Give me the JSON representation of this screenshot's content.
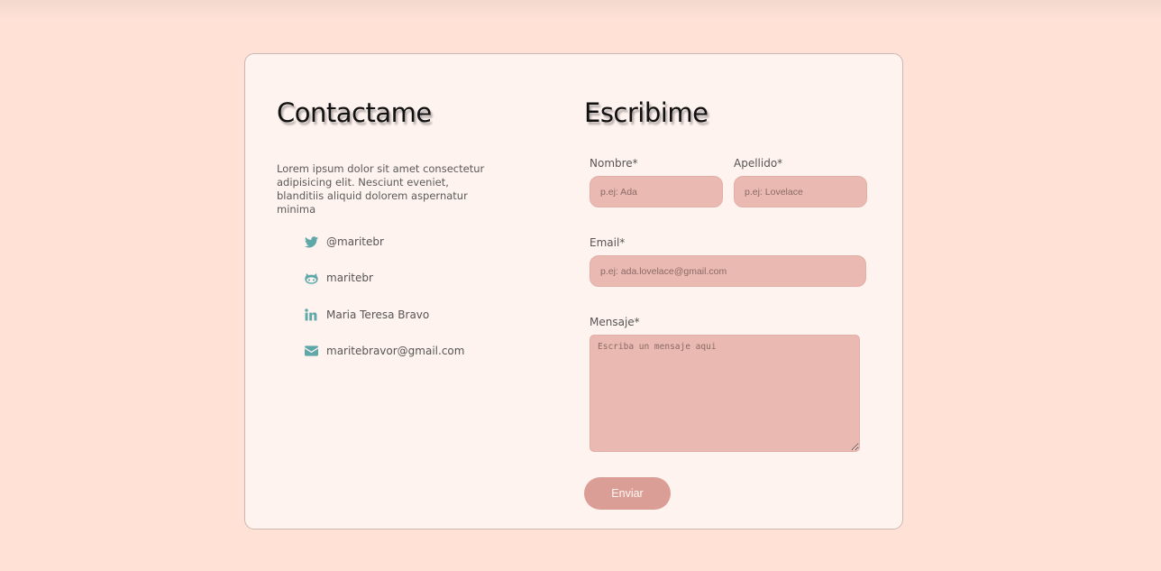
{
  "contact": {
    "title": "Contactame",
    "description": "Lorem ipsum dolor sit amet consectetur adipisicing elit. Nesciunt eveniet, blanditiis aliquid dolorem aspernatur minima",
    "items": [
      {
        "icon": "twitter-icon",
        "label": "@maritebr"
      },
      {
        "icon": "github-icon",
        "label": "maritebr"
      },
      {
        "icon": "linkedin-icon",
        "label": "Maria Teresa Bravo"
      },
      {
        "icon": "envelope-icon",
        "label": "maritebravor@gmail.com"
      }
    ]
  },
  "form": {
    "title": "Escribime",
    "nombre": {
      "label": "Nombre*",
      "placeholder": "p.ej: Ada"
    },
    "apellido": {
      "label": "Apellido*",
      "placeholder": "p.ej: Lovelace"
    },
    "email": {
      "label": "Email*",
      "placeholder": "p.ej: ada.lovelace@gmail.com"
    },
    "mensaje": {
      "label": "Mensaje*",
      "placeholder": "Escriba un mensaje aqui"
    },
    "submit_label": "Enviar"
  },
  "colors": {
    "page_background": "#ffe1d6",
    "card_background": "#fff3ef",
    "input_background": "#eab9b1",
    "button_background": "#db9e96",
    "icon_color": "#5fa8a9"
  }
}
